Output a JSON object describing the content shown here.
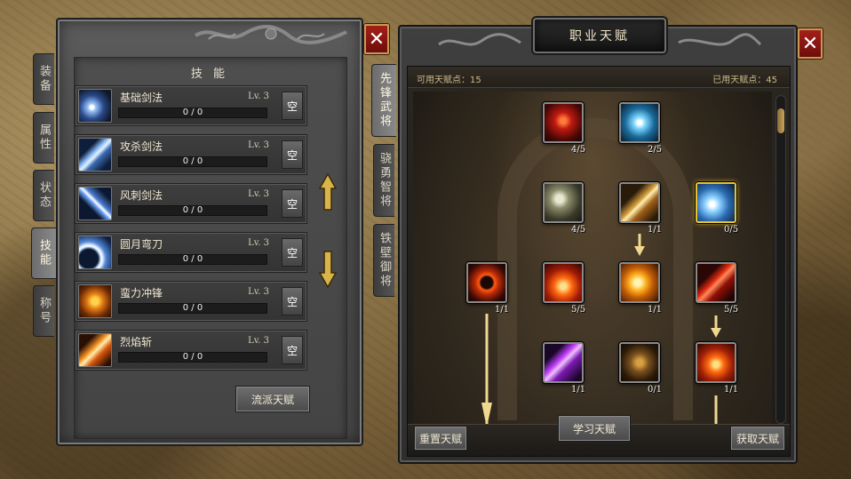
{
  "left_panel": {
    "title": "技 能",
    "close_label": "✕",
    "tabs": [
      {
        "label": "装备",
        "active": false
      },
      {
        "label": "属性",
        "active": false
      },
      {
        "label": "状态",
        "active": false
      },
      {
        "label": "技能",
        "active": true
      },
      {
        "label": "称号",
        "active": false
      }
    ],
    "skills": [
      {
        "name": "基础剑法",
        "level": "Lv. 3",
        "progress": "0 / 0",
        "key": "空",
        "icon": "sword-slash-icon"
      },
      {
        "name": "攻杀剑法",
        "level": "Lv. 3",
        "progress": "0 / 0",
        "key": "空",
        "icon": "blade-strike-icon"
      },
      {
        "name": "风刺剑法",
        "level": "Lv. 3",
        "progress": "0 / 0",
        "key": "空",
        "icon": "wind-thrust-icon"
      },
      {
        "name": "圆月弯刀",
        "level": "Lv. 3",
        "progress": "0 / 0",
        "key": "空",
        "icon": "crescent-blade-icon"
      },
      {
        "name": "蛮力冲锋",
        "level": "Lv. 3",
        "progress": "0 / 0",
        "key": "空",
        "icon": "charge-icon"
      },
      {
        "name": "烈焰斩",
        "level": "Lv. 3",
        "progress": "0 / 0",
        "key": "空",
        "icon": "flame-slash-icon"
      }
    ],
    "school_talent_button": "流派天赋"
  },
  "right_panel": {
    "title": "职业天赋",
    "close_label": "✕",
    "tabs": [
      {
        "label": "先锋武将",
        "active": true
      },
      {
        "label": "骁勇智将",
        "active": false
      },
      {
        "label": "铁壁御将",
        "active": false
      }
    ],
    "available_points": "可用天赋点：15",
    "used_points": "已用天赋点：45",
    "nodes": [
      {
        "count": "4/5",
        "icon": "rage-warrior-icon",
        "selected": false
      },
      {
        "count": "2/5",
        "icon": "ice-crystal-icon",
        "selected": false
      },
      {
        "count": "4/5",
        "icon": "whirlwind-axe-icon",
        "selected": false
      },
      {
        "count": "1/1",
        "icon": "golden-slash-icon",
        "selected": false
      },
      {
        "count": "0/5",
        "icon": "frost-blade-icon",
        "selected": true
      },
      {
        "count": "1/1",
        "icon": "fire-ring-icon",
        "selected": false
      },
      {
        "count": "5/5",
        "icon": "flame-burst-icon",
        "selected": false
      },
      {
        "count": "1/1",
        "icon": "fire-wheel-icon",
        "selected": false
      },
      {
        "count": "5/5",
        "icon": "blood-blade-icon",
        "selected": false
      },
      {
        "count": "1/1",
        "icon": "purple-shadow-icon",
        "selected": false
      },
      {
        "count": "0/1",
        "icon": "running-warrior-icon",
        "selected": false
      },
      {
        "count": "1/1",
        "icon": "inferno-fist-icon",
        "selected": false
      }
    ],
    "reset_button": "重置天赋",
    "learn_button": "学习天赋",
    "obtain_button": "获取天赋"
  },
  "colors": {
    "gold_border": "#e6c233",
    "close_red": "#a4201a",
    "points_text": "#cdb98a"
  }
}
